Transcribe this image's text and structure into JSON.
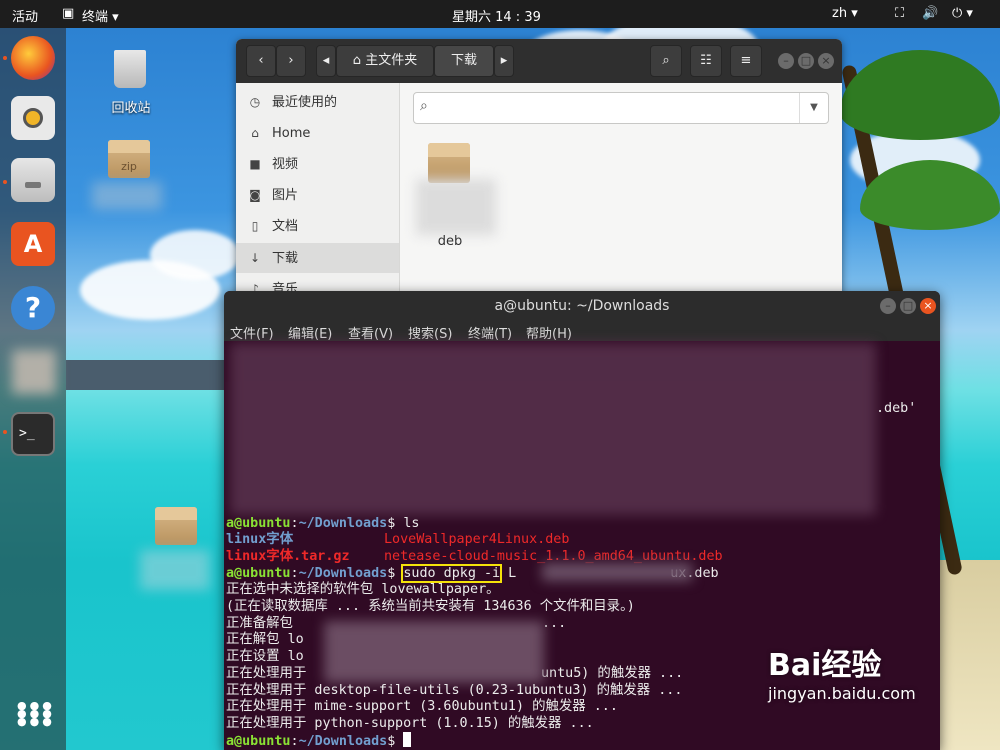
{
  "topbar": {
    "activities": "活动",
    "app_menu": "终端",
    "clock": "星期六 14 : 39",
    "lang": "zh"
  },
  "desktop": {
    "trash_label": "回收站",
    "zip_label": "zip"
  },
  "dock_dots_color": "#e95420",
  "file_manager": {
    "path_home": "主文件夹",
    "path_current": "下载",
    "sidebar": [
      {
        "label": "最近使用的",
        "icon": "clock-icon"
      },
      {
        "label": "Home",
        "icon": "home-icon"
      },
      {
        "label": "视频",
        "icon": "video-icon"
      },
      {
        "label": "图片",
        "icon": "camera-icon"
      },
      {
        "label": "文档",
        "icon": "document-icon"
      },
      {
        "label": "下载",
        "icon": "download-icon"
      },
      {
        "label": "音乐",
        "icon": "music-icon"
      }
    ],
    "file_label": "deb"
  },
  "terminal": {
    "title": "a@ubuntu: ~/Downloads",
    "menu": [
      "文件(F)",
      "编辑(E)",
      "查看(V)",
      "搜索(S)",
      "终端(T)",
      "帮助(H)"
    ],
    "partial_deb": ".deb'",
    "prompt_user": "a@ubuntu",
    "prompt_path": "~/Downloads",
    "cmd_ls": "ls",
    "ls_row1_a": "linux字体",
    "ls_row1_b": "LoveWallpaper4Linux.deb",
    "ls_row2_a": "linux字体.tar.gz",
    "ls_row2_b": "netease-cloud-music_1.1.0_amd64_ubuntu.deb",
    "cmd_dpkg": "sudo dpkg -i",
    "cmd_dpkg_tail": "ux.deb",
    "out": [
      "正在选中未选择的软件包 lovewallpaper。",
      "(正在读取数据库 ... 系统当前共安装有 134636 个文件和目录。)",
      "正准备解包",
      "正在解包 lo",
      "正在设置 lo",
      "正在处理用于",
      "正在处理用于 desktop-file-utils (0.23-1ubuntu3) 的触发器 ...",
      "正在处理用于 mime-support (3.60ubuntu1) 的触发器 ...",
      "正在处理用于 python-support (1.0.15) 的触发器 ..."
    ],
    "out_tail_a": "...",
    "out_tail_b": "untu5) 的触发器 ..."
  },
  "watermark": {
    "brand": "Bai经验",
    "url": "jingyan.baidu.com"
  }
}
